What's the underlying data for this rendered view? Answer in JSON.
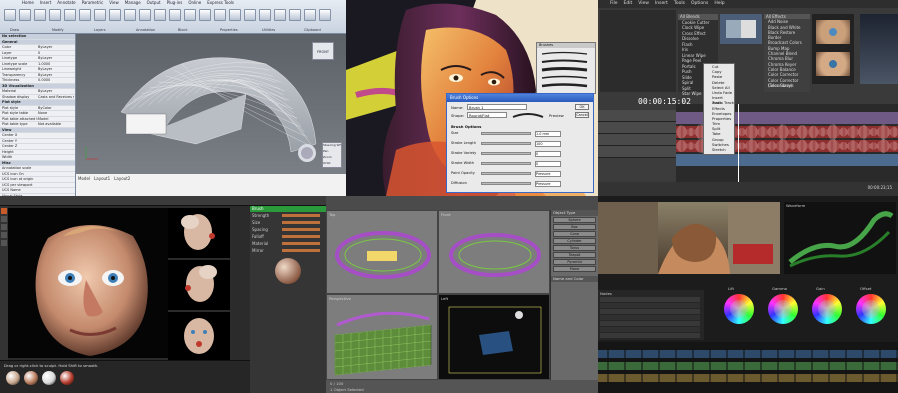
{
  "cad": {
    "ribbon_tabs": [
      "Home",
      "Insert",
      "Annotate",
      "Parametric",
      "View",
      "Manage",
      "Output",
      "Plug-ins",
      "Online",
      "Express Tools"
    ],
    "ribbon_groups": [
      "Draw",
      "Modify",
      "Layers",
      "Annotation",
      "Block",
      "Properties",
      "Utilities",
      "Clipboard"
    ],
    "properties": {
      "header": "No selection",
      "sections": [
        {
          "title": "General",
          "rows": [
            "Color",
            "Layer",
            "Linetype",
            "Linetype scale",
            "Lineweight",
            "Transparency",
            "Thickness"
          ]
        },
        {
          "title": "3D Visualization",
          "rows": [
            "Material",
            "Shadow display"
          ]
        },
        {
          "title": "Plot style",
          "rows": [
            "Plot style",
            "Plot style table",
            "Plot table attached to",
            "Plot table type"
          ]
        },
        {
          "title": "View",
          "rows": [
            "Center X",
            "Center Y",
            "Center Z",
            "Height",
            "Width"
          ]
        },
        {
          "title": "Misc",
          "rows": [
            "Annotation scale",
            "UCS icon On",
            "UCS icon at origin",
            "UCS per viewport",
            "UCS Name",
            "Visual Style"
          ]
        }
      ],
      "values": [
        "ByLayer",
        "0",
        "ByLayer",
        "1.0000",
        "ByLayer",
        "ByLayer",
        "0.0000",
        "ByLayer",
        "Casts and Receives shadows",
        "ByColor",
        "None",
        "Model",
        "Not available"
      ]
    },
    "viewcube": {
      "face": "FRONT"
    },
    "nav_labels": [
      "Steering Wheels",
      "Pan",
      "Zoom",
      "Orbit"
    ],
    "tabs": [
      "Model",
      "Layout1",
      "Layout2"
    ]
  },
  "paint": {
    "dialog_title": "Brush Options",
    "name_label": "Name:",
    "name_value": "Brush 1",
    "shape_label": "Shape:",
    "shape_value": "Round/Flat",
    "preview_label": "Preview",
    "sections": [
      "Brush Options"
    ],
    "sliders": [
      {
        "label": "Size",
        "value": "1.0 mm"
      },
      {
        "label": "Stroke Length",
        "value": "100"
      },
      {
        "label": "Stroke Variety",
        "value": "0"
      },
      {
        "label": "Stroke Width",
        "value": "0"
      },
      {
        "label": "Paint Opacity",
        "value": "Pressure"
      },
      {
        "label": "Diffusion",
        "value": "Pressure"
      }
    ],
    "buttons": [
      "OK",
      "Cancel"
    ],
    "panel_title": "Brushes"
  },
  "video": {
    "menu": [
      "File",
      "Edit",
      "View",
      "Insert",
      "Tools",
      "Options",
      "Help"
    ],
    "timecode": "00:00:15;02",
    "fx_header": "All Effects",
    "fx_items": [
      "Add Noise",
      "Black and White",
      "Black Restore",
      "Border",
      "Broadcast Colors",
      "Bump Map",
      "Channel Blend",
      "Chroma Blur",
      "Chroma Keyer",
      "Color Balance",
      "Color Corrector",
      "Color Corrector (Secondary)",
      "Color Curves"
    ],
    "preset_header": "All Blends",
    "preset_items": [
      "Cookie Cutter",
      "Clock Wipe",
      "Cross Effect",
      "Dissolve",
      "Flash",
      "Iris",
      "Linear Wipe",
      "Page Peel",
      "Portals",
      "Push",
      "Slide",
      "Spiral",
      "Split",
      "Star Wipe"
    ],
    "context_menu": [
      "Cut",
      "Copy",
      "Paste",
      "Delete",
      "Select All",
      "Undo Fade",
      "Insert Track",
      "Audio Track",
      "Effects",
      "Envelopes",
      "Properties",
      "Trim",
      "Split",
      "Take",
      "Group",
      "Switches",
      "Stretch",
      "Synchronize",
      "Video Event FX"
    ],
    "end_time": "00:00:23;15"
  },
  "sculpt": {
    "status": "Drag or right-click to sculpt. Hold Shift to smooth.",
    "panel_header": "Brush",
    "attrs": [
      "Strength",
      "Size",
      "Spacing",
      "Falloff",
      "Material",
      "Mirror"
    ],
    "materials": [
      "Clay",
      "Skin",
      "Chrome",
      "Red Wax"
    ]
  },
  "max": {
    "views": [
      "Top",
      "Front",
      "Perspective",
      "Left"
    ],
    "cmd_header": "Object Type",
    "cmd_buttons": [
      "Sphere",
      "Box",
      "Cone",
      "Cylinder",
      "Torus",
      "Teapot",
      "Pyramid",
      "Plane"
    ],
    "cmd_section": "Name and Color",
    "timeline": "0 / 100",
    "status": "1 Object Selected"
  },
  "grade": {
    "wheel_labels": [
      "Lift",
      "Gamma",
      "Gain",
      "Offset"
    ],
    "scope_label": "Waveform",
    "node_label": "Nodes"
  }
}
